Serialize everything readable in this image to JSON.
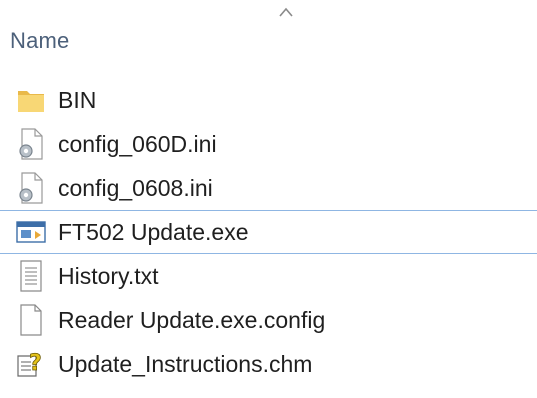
{
  "header": {
    "name_column": "Name",
    "sort_icon": "chevron-up-icon"
  },
  "files": [
    {
      "name": "BIN",
      "icon": "folder-icon",
      "selected": false
    },
    {
      "name": "config_060D.ini",
      "icon": "config-file-icon",
      "selected": false
    },
    {
      "name": "config_0608.ini",
      "icon": "config-file-icon",
      "selected": false
    },
    {
      "name": "FT502 Update.exe",
      "icon": "application-icon",
      "selected": true
    },
    {
      "name": "History.txt",
      "icon": "text-file-icon",
      "selected": false
    },
    {
      "name": "Reader Update.exe.config",
      "icon": "blank-file-icon",
      "selected": false
    },
    {
      "name": "Update_Instructions.chm",
      "icon": "help-file-icon",
      "selected": false
    }
  ],
  "colors": {
    "header_text": "#4c607a",
    "selection_border": "#8fb6e3",
    "folder": "#f8d775"
  }
}
